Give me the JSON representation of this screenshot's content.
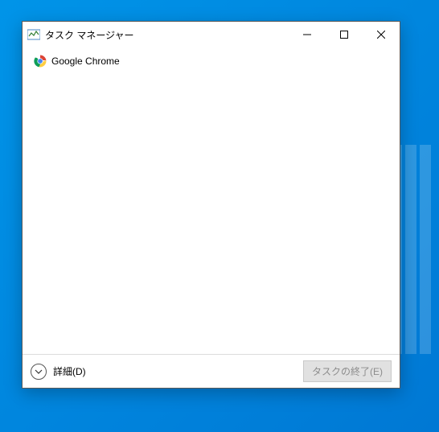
{
  "window": {
    "title": "タスク マネージャー"
  },
  "tasks": [
    {
      "name": "Google Chrome",
      "icon": "chrome-icon"
    }
  ],
  "footer": {
    "detailsLabel": "詳細(D)",
    "endTaskLabel": "タスクの終了(E)"
  }
}
